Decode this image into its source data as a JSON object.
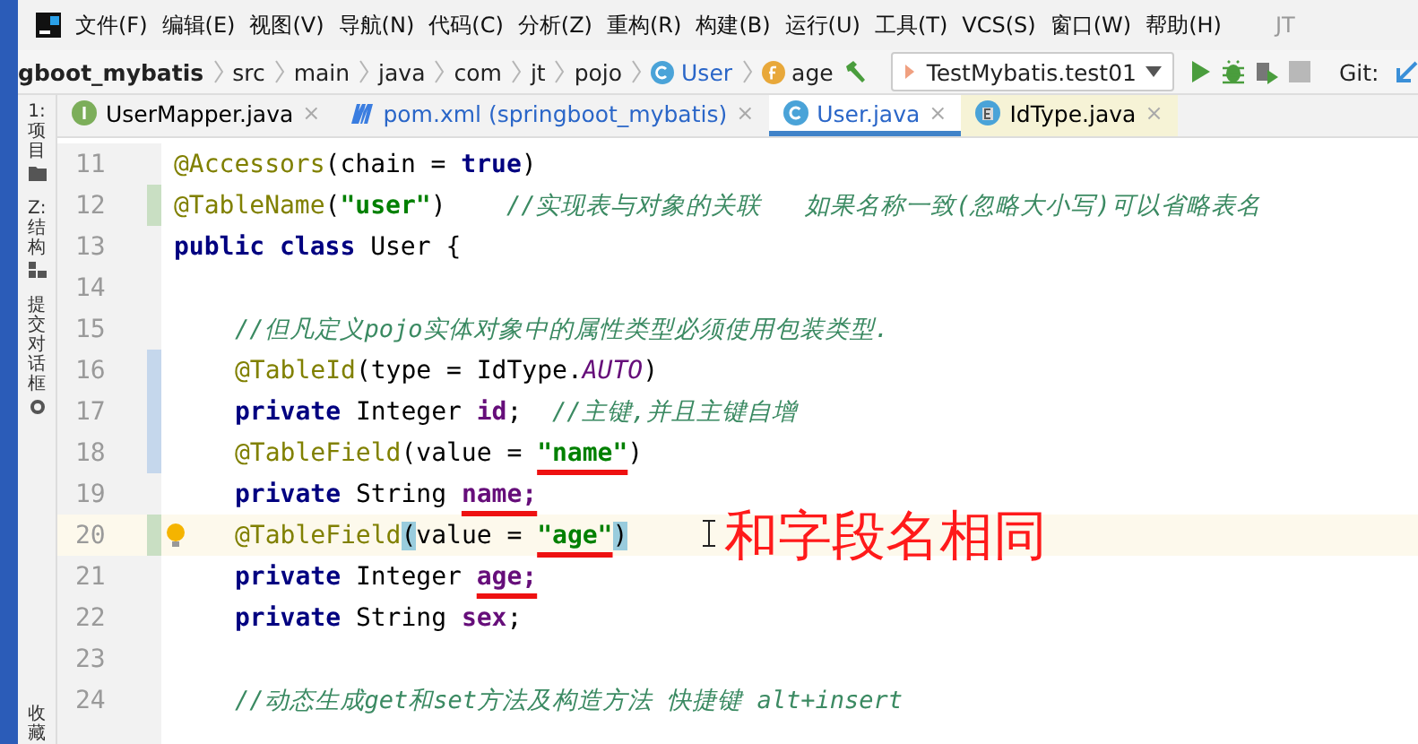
{
  "menu_bar": {
    "items": [
      "文件(F)",
      "编辑(E)",
      "视图(V)",
      "导航(N)",
      "代码(C)",
      "分析(Z)",
      "重构(R)",
      "构建(B)",
      "运行(U)",
      "工具(T)",
      "VCS(S)",
      "窗口(W)",
      "帮助(H)"
    ],
    "user": "JT"
  },
  "navigation_bar": {
    "breadcrumbs": [
      {
        "text": "gboot_mybatis",
        "kind": "project"
      },
      {
        "text": "src",
        "kind": "folder"
      },
      {
        "text": "main",
        "kind": "folder"
      },
      {
        "text": "java",
        "kind": "folder"
      },
      {
        "text": "com",
        "kind": "folder"
      },
      {
        "text": "jt",
        "kind": "folder"
      },
      {
        "text": "pojo",
        "kind": "folder"
      },
      {
        "text": "User",
        "kind": "class"
      },
      {
        "text": "age",
        "kind": "field"
      }
    ],
    "run_config": "TestMybatis.test01",
    "vcs_label": "Git:"
  },
  "side_tools": [
    {
      "label": "1: 项目",
      "kind": "project"
    },
    {
      "label": "Z: 结构",
      "kind": "structure"
    },
    {
      "label": "提交对话框",
      "kind": "commit"
    },
    {
      "label": "收藏",
      "kind": "favorites"
    }
  ],
  "tabs": [
    {
      "label": "UserMapper.java",
      "kind": "interface",
      "selected": false,
      "close": "×"
    },
    {
      "label": "pom.xml (springboot_mybatis)",
      "kind": "maven",
      "selected": false,
      "close": "×"
    },
    {
      "label": "User.java",
      "kind": "class",
      "selected": true,
      "close": "×"
    },
    {
      "label": "IdType.java",
      "kind": "enum",
      "selected": false,
      "close": "×"
    }
  ],
  "editor": {
    "lines": [
      {
        "number": "11",
        "tokens": [
          {
            "kind": "annotation",
            "text": "@Accessors"
          },
          {
            "kind": "plain",
            "text": "(chain = "
          },
          {
            "kind": "keyword",
            "text": "true"
          },
          {
            "kind": "plain",
            "text": ")"
          }
        ]
      },
      {
        "number": "12",
        "color": "#c9dfc3",
        "tokens": [
          {
            "kind": "annotation",
            "text": "@TableName"
          },
          {
            "kind": "plain",
            "text": "("
          },
          {
            "kind": "string",
            "text": "\"user\""
          },
          {
            "kind": "plain",
            "text": ")    "
          },
          {
            "kind": "comment",
            "text": "//实现表与对象的关联   如果名称一致(忽略大小写)可以省略表名"
          }
        ]
      },
      {
        "number": "13",
        "tokens": [
          {
            "kind": "keyword",
            "text": "public class "
          },
          {
            "kind": "plain",
            "text": "User {"
          }
        ],
        "children": [
          {
            "number": "14"
          },
          {
            "number": "15",
            "tokens": [
              {
                "kind": "comment",
                "text": "//但凡定义pojo实体对象中的属性类型必须使用包装类型."
              }
            ]
          },
          {
            "number": "16",
            "color": "#c5d7ec",
            "tokens": [
              {
                "kind": "annotation",
                "text": "@TableId"
              },
              {
                "kind": "plain",
                "text": "(type = IdType."
              },
              {
                "kind": "constant",
                "text": "AUTO"
              },
              {
                "kind": "plain",
                "text": ")"
              }
            ]
          },
          {
            "number": "17",
            "color": "#c5d7ec",
            "tokens": [
              {
                "kind": "keyword",
                "text": "private "
              },
              {
                "kind": "plain",
                "text": "Integer "
              },
              {
                "kind": "field",
                "text": "id"
              },
              {
                "kind": "plain",
                "text": ";  "
              },
              {
                "kind": "comment",
                "text": "//主键,并且主键自增"
              }
            ]
          },
          {
            "number": "18",
            "color": "#c5d7ec",
            "tokens": [
              {
                "kind": "annotation",
                "text": "@TableField"
              },
              {
                "kind": "plain",
                "text": "(value = "
              },
              {
                "kind": "string",
                "text": "\"name\"",
                "underlined": true
              },
              {
                "kind": "plain",
                "text": ")"
              }
            ]
          },
          {
            "number": "19",
            "tokens": [
              {
                "kind": "keyword",
                "text": "private "
              },
              {
                "kind": "plain",
                "text": "String "
              },
              {
                "kind": "field",
                "text": "name;",
                "underlined": true
              }
            ]
          },
          {
            "number": "20",
            "color": "#c9dfc3",
            "current": true,
            "bulb": true,
            "tokens": [
              {
                "kind": "annotation",
                "text": "@TableField"
              },
              {
                "kind": "plain",
                "text": "(",
                "matched": true
              },
              {
                "kind": "plain",
                "text": "value = "
              },
              {
                "kind": "string",
                "text": "\"age\"",
                "underlined": true
              },
              {
                "kind": "plain",
                "text": ")",
                "matched": true
              }
            ]
          },
          {
            "number": "21",
            "tokens": [
              {
                "kind": "keyword",
                "text": "private "
              },
              {
                "kind": "plain",
                "text": "Integer "
              },
              {
                "kind": "field",
                "text": "age;",
                "underlined": true
              }
            ]
          },
          {
            "number": "22",
            "tokens": [
              {
                "kind": "keyword",
                "text": "private "
              },
              {
                "kind": "plain",
                "text": "String "
              },
              {
                "kind": "field",
                "text": "sex"
              },
              {
                "kind": "plain",
                "text": ";"
              }
            ]
          },
          {
            "number": "23"
          },
          {
            "number": "24",
            "tokens": [
              {
                "kind": "comment",
                "text": "//动态生成get和set方法及构造方法 快捷键 alt+insert"
              }
            ]
          }
        ]
      }
    ],
    "note": "和字段名相同"
  }
}
